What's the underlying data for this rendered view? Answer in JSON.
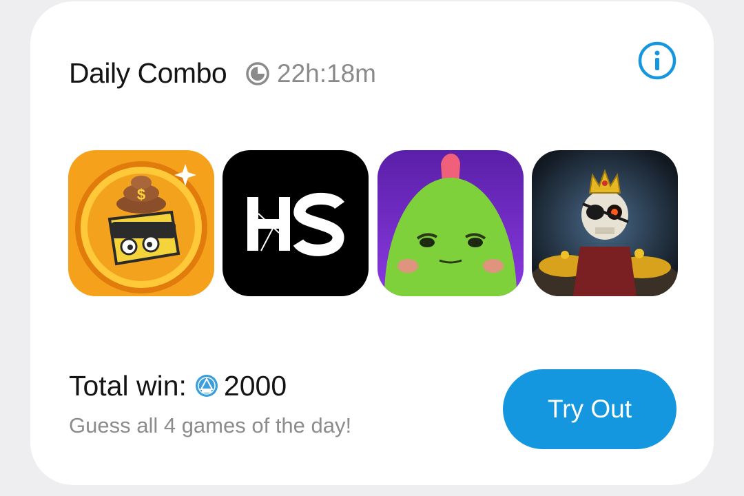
{
  "header": {
    "title": "Daily Combo",
    "timer_icon": "clock-icon",
    "timer_text": "22h:18m",
    "info_icon": "info-icon"
  },
  "games": [
    {
      "name": "coin-thief-game",
      "colors": [
        "#f4a21b",
        "#ffd23a"
      ]
    },
    {
      "name": "hs-game",
      "label": "HS",
      "colors": [
        "#000000",
        "#ffffff"
      ]
    },
    {
      "name": "green-blob-game",
      "colors": [
        "#7a2fcf",
        "#7ed13a"
      ]
    },
    {
      "name": "skeleton-pirate-game",
      "colors": [
        "#1e2430",
        "#e0a81c"
      ]
    }
  ],
  "footer": {
    "total_win_label": "Total win:",
    "coin_icon": "coin-icon",
    "total_win_value": "2000",
    "subtitle": "Guess all 4 games of the day!",
    "button_label": "Try Out"
  },
  "colors": {
    "accent": "#1597e0",
    "muted_text": "#8a8a8a",
    "card_background": "#ffffff",
    "page_background": "#eeeef0"
  }
}
